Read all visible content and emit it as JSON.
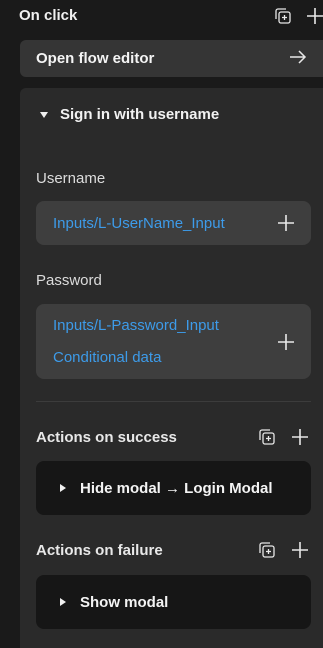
{
  "header": {
    "title": "On click"
  },
  "flow_editor": {
    "label": "Open flow editor"
  },
  "section": {
    "title": "Sign in with username"
  },
  "username": {
    "label": "Username",
    "value": "Inputs/L-UserName_Input"
  },
  "password": {
    "label": "Password",
    "value": "Inputs/L-Password_Input",
    "extra": "Conditional data"
  },
  "success": {
    "label": "Actions on success",
    "action": "Hide modal → Login Modal"
  },
  "failure": {
    "label": "Actions on failure",
    "action": "Show modal"
  },
  "colors": {
    "accent": "#3d9be9",
    "panel": "#2a2a2a",
    "field": "#3e3e3e",
    "action_box": "#161616"
  },
  "icons": [
    "add-to-group-icon",
    "plus-icon",
    "arrow-right-icon",
    "triangle-down-icon",
    "triangle-right-icon"
  ]
}
